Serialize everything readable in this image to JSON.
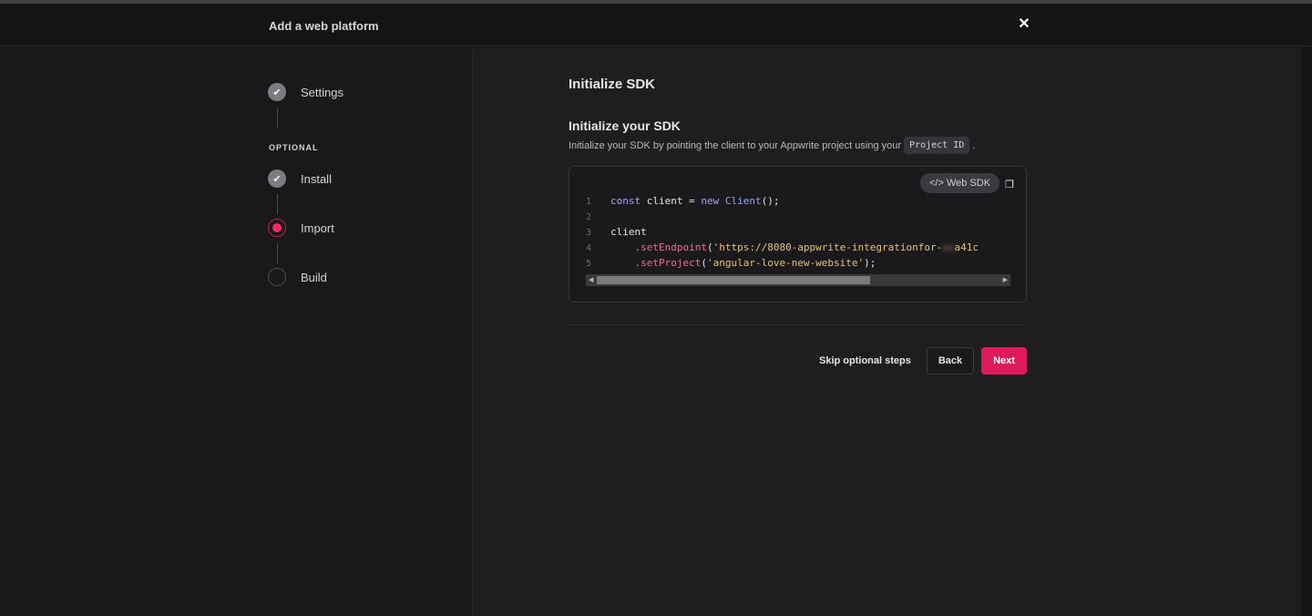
{
  "header": {
    "title": "Add a web platform",
    "close_icon": "close-icon"
  },
  "steps": [
    {
      "label": "Settings",
      "state": "done"
    },
    {
      "label": "Install",
      "state": "done"
    },
    {
      "label": "Import",
      "state": "current"
    },
    {
      "label": "Build",
      "state": "todo"
    }
  ],
  "optional_label": "OPTIONAL",
  "main": {
    "title": "Initialize SDK",
    "subtitle": "Initialize your SDK",
    "description": "Initialize your SDK by pointing the client to your Appwrite project using your",
    "description_end": ".",
    "project_id_chip": "Project ID",
    "sdk_badge": "</> Web SDK",
    "code_lines": [
      "1",
      "2",
      "3",
      "4",
      "5"
    ],
    "code": {
      "l1_kw": "const",
      "l1_var": " client = ",
      "l1_new": "new",
      "l1_cls": " Client",
      "l1_end": "();",
      "l3": "client",
      "l4_fn": "    .setEndpoint",
      "l4_p": "(",
      "l4_str": "'https://8080-appwrite-integrationfor-",
      "l4_tail": "a41c",
      "l5_fn": "    .setProject",
      "l5_p": "(",
      "l5_str": "'angular-love-new-website'",
      "l5_end": ");"
    }
  },
  "footer": {
    "skip": "Skip optional steps",
    "back": "Back",
    "next": "Next"
  },
  "colors": {
    "accent": "#e0195a",
    "background": "#1e1e21"
  }
}
